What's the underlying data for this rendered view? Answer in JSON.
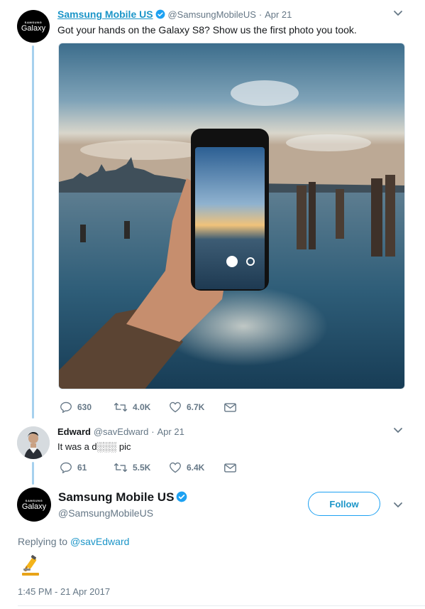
{
  "tweet1": {
    "name": "Samsung Mobile US",
    "handle": "@SamsungMobileUS",
    "separator": "·",
    "date": "Apr 21",
    "text": "Got your hands on the Galaxy S8? Show us the first photo you took.",
    "avatar_top": "SAMSUNG",
    "avatar_brand": "Galaxy",
    "replies": "630",
    "retweets": "4.0K",
    "likes": "6.7K"
  },
  "tweet2": {
    "name": "Edward",
    "handle": "@savEdward",
    "separator": "·",
    "date": "Apr 21",
    "text": "It was a d░░░ pic",
    "replies": "61",
    "retweets": "5.5K",
    "likes": "6.4K"
  },
  "tweet3": {
    "name": "Samsung Mobile US",
    "handle": "@SamsungMobileUS",
    "avatar_top": "SAMSUNG",
    "avatar_brand": "Galaxy",
    "follow_label": "Follow",
    "replying_prefix": "Replying to",
    "replying_handle": "@savEdward",
    "emoji_name": "microscope",
    "timestamp": "1:45 PM - 21 Apr 2017"
  },
  "colors": {
    "link": "#1b95c8",
    "thread": "#a6d1ee",
    "muted": "#657786",
    "verified": "#1da1f2"
  }
}
